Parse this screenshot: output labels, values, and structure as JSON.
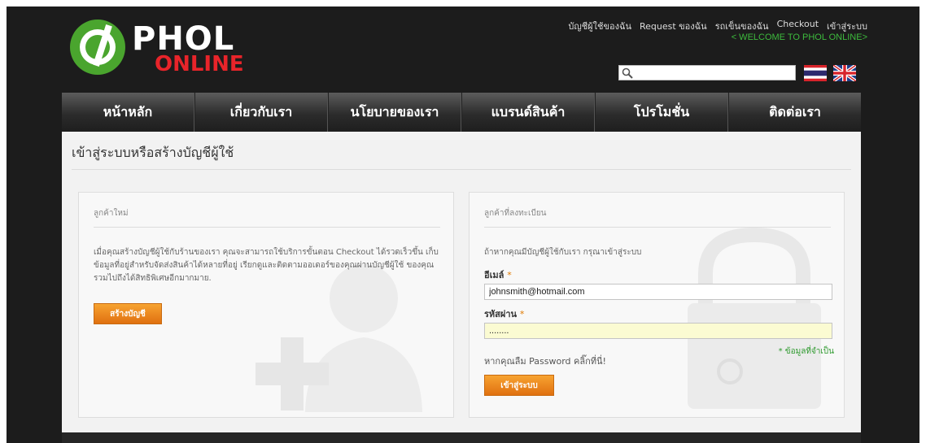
{
  "brand": {
    "name_top": "PHOL",
    "name_bottom": "ONLINE"
  },
  "header": {
    "links": [
      "บัญชีผู้ใช้ของฉัน",
      "Request ของฉัน",
      "รถเข็นของฉัน",
      "Checkout",
      "เข้าสู่ระบบ"
    ],
    "welcome": "< WELCOME TO PHOL ONLINE>"
  },
  "search": {
    "placeholder": "",
    "value": ""
  },
  "nav": {
    "items": [
      "หน้าหลัก",
      "เกี่ยวกับเรา",
      "นโยบายของเรา",
      "แบรนด์สินค้า",
      "โปรโมชั่น",
      "ติดต่อเรา"
    ]
  },
  "page": {
    "title": "เข้าสู่ระบบหรือสร้างบัญชีผู้ใช้"
  },
  "new_customer": {
    "heading": "ลูกค้าใหม่",
    "text": "เมื่อคุณสร้างบัญชีผู้ใช้กับร้านของเรา คุณจะสามารถใช้บริการขั้นตอน Checkout ได้รวดเร็วขึ้น เก็บข้อมูลที่อยู่สำหรับจัดส่งสินค้าได้หลายที่อยู่ เรียกดูและติดตามออเดอร์ของคุณผ่านบัญชีผู้ใช้ ของคุณรวมไปถึงได้สิทธิพิเศษอีกมากมาย.",
    "button": "สร้างบัญชี"
  },
  "registered": {
    "heading": "ลูกค้าที่ลงทะเบียน",
    "text": "ถ้าหากคุณมีบัญชีผู้ใช้กับเรา กรุณาเข้าสู่ระบบ",
    "email_label": "อีเมล์",
    "email_value": "johnsmith@hotmail.com",
    "password_label": "รหัสผ่าน",
    "password_value": "........",
    "required_mark": "*",
    "required_note": "* ข้อมูลที่จำเป็น",
    "forgot": "หากคุณลืม Password คลิ๊กที่นี่!",
    "button": "เข้าสู่ระบบ"
  },
  "colors": {
    "accent": "#f08c1e",
    "green": "#3dbb3d",
    "red": "#e8242a"
  }
}
